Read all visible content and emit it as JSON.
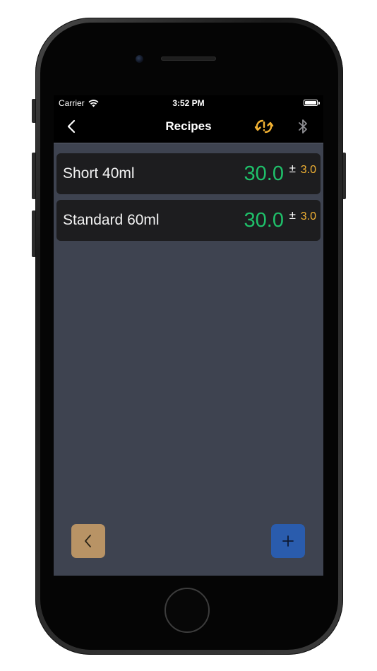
{
  "status_bar": {
    "carrier": "Carrier",
    "time": "3:52 PM",
    "icons": [
      "wifi-icon",
      "battery-icon"
    ]
  },
  "nav": {
    "title": "Recipes",
    "icons": [
      "chevron-left-icon",
      "sync-icon",
      "bluetooth-icon"
    ],
    "accent_color": "#f2b233"
  },
  "recipes": [
    {
      "name": "Short 40ml",
      "target": "30.0",
      "pm": "±",
      "tolerance": "3.0"
    },
    {
      "name": "Standard 60ml",
      "target": "30.0",
      "pm": "±",
      "tolerance": "3.0"
    }
  ],
  "buttons": {
    "back_icon": "chevron-left-icon",
    "add_icon": "plus-icon",
    "back_color": "#b89365",
    "add_color": "#2a5cad"
  },
  "colors": {
    "target_value": "#1fc06a",
    "tolerance_value": "#f2b233",
    "background": "#3e4350"
  }
}
